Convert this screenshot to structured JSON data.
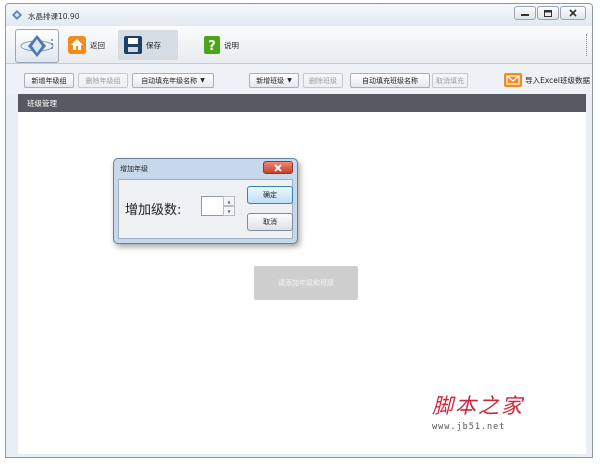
{
  "window": {
    "title": "水晶排课10.90",
    "controls": {
      "minimize_icon": "minimize-icon",
      "maximize_icon": "maximize-icon",
      "close_icon": "close-icon"
    }
  },
  "toolbar": {
    "logo_icon": "crystal-logo-icon",
    "buttons": [
      {
        "label": "返回",
        "icon": "home-icon",
        "color": "#f28c1e"
      },
      {
        "label": "保存",
        "icon": "floppy-save-icon",
        "color": "#1e3f66"
      },
      {
        "label": "说明",
        "icon": "help-icon",
        "color": "#4aa51c"
      }
    ]
  },
  "actions": {
    "add_grade_group": "新增年级组",
    "delete_grade_group": "删除年级组",
    "auto_fill_grade_name": "自动填充年级名称",
    "add_class": "新增班级",
    "delete_class": "删除班级",
    "auto_fill_class_name": "自动填充班级名称",
    "cancel_fill": "取消填充",
    "import_excel": "导入Excel班级数据"
  },
  "panel": {
    "title": "班级管理",
    "placeholder_button": "请添加年级和班级"
  },
  "dialog": {
    "title": "增加年级",
    "field_label": "增加级数:",
    "field_value": "",
    "ok_label": "确定",
    "cancel_label": "取消"
  },
  "watermark": {
    "text": "脚本之家",
    "url": "www.jb51.net"
  },
  "colors": {
    "panel_header": "#555a60",
    "close_red": "#c4412b",
    "watermark_red": "#c8283d"
  }
}
